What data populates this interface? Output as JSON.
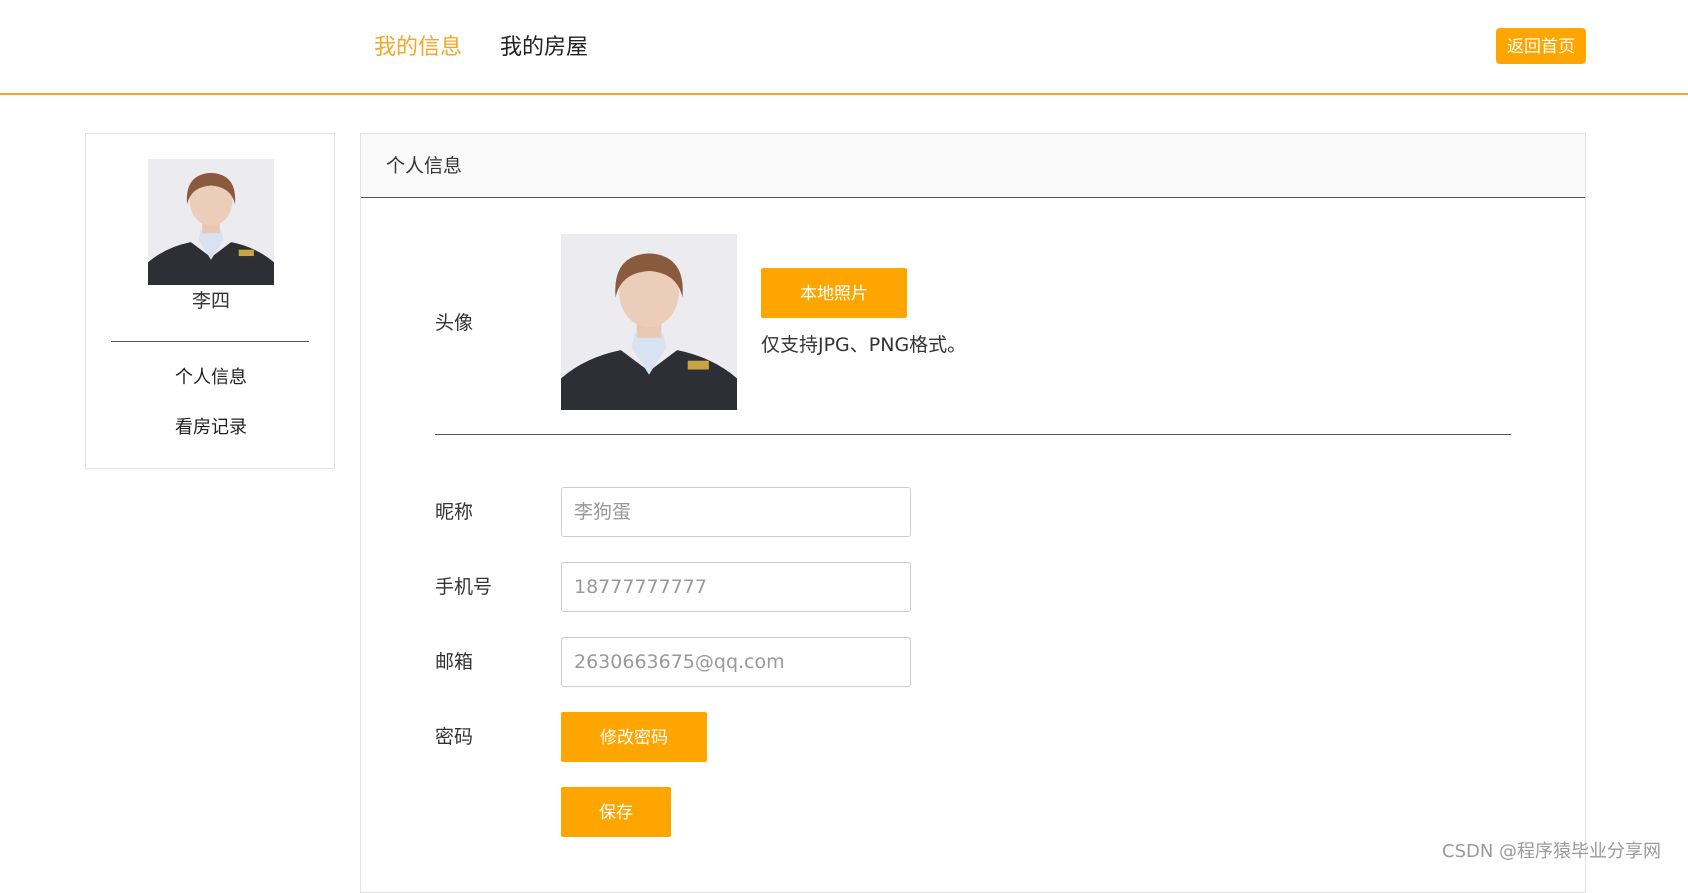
{
  "nav": {
    "tabs": [
      {
        "label": "我的信息",
        "active": true
      },
      {
        "label": "我的房屋",
        "active": false
      }
    ],
    "home_button": "返回首页",
    "accent_color": "#f5a623"
  },
  "sidebar": {
    "user_name": "李四",
    "avatar": "portrait-photo",
    "items": [
      {
        "label": "个人信息"
      },
      {
        "label": "看房记录"
      }
    ]
  },
  "panel": {
    "title": "个人信息",
    "avatar": {
      "label": "头像",
      "upload_button": "本地照片",
      "hint": "仅支持JPG、PNG格式。"
    },
    "fields": {
      "nickname": {
        "label": "昵称",
        "placeholder": "李狗蛋"
      },
      "phone": {
        "label": "手机号",
        "placeholder": "18777777777"
      },
      "email": {
        "label": "邮箱",
        "placeholder": "2630663675@qq.com"
      },
      "password": {
        "label": "密码",
        "button": "修改密码"
      }
    },
    "save_button": "保存"
  },
  "watermark": "CSDN @程序猿毕业分享网"
}
